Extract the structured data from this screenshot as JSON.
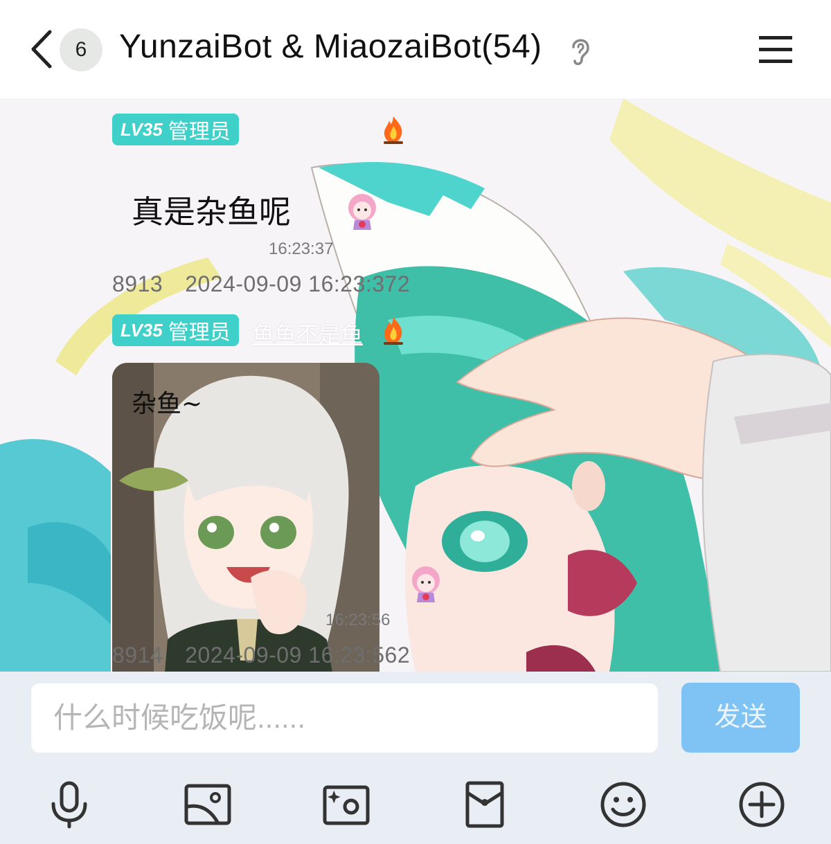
{
  "header": {
    "unread_count": "6",
    "title": "YunzaiBot & MiaozaiBot(54)"
  },
  "messages": [
    {
      "level": "LV35",
      "role": "管理员",
      "text": "真是杂鱼呢",
      "time": "16:23:37",
      "meta_id": "8913",
      "meta_datetime": "2024-09-09 16:23:372"
    },
    {
      "level": "LV35",
      "role": "管理员",
      "nickname": "鱼鱼不是鱼",
      "image_caption": "杂鱼~",
      "time": "16:23:56",
      "meta_id": "8914",
      "meta_datetime": "2024-09-09 16:23:562"
    }
  ],
  "input": {
    "placeholder": "什么时候吃饭呢......"
  },
  "send_label": "发送",
  "toolbar_icons": [
    "microphone-icon",
    "image-icon",
    "camera-icon",
    "red-packet-icon",
    "emoji-icon",
    "plus-icon"
  ],
  "colors": {
    "level_badge": "#3fd0c9",
    "send_button": "#7ec3f4",
    "input_bar": "#e8eef3"
  }
}
